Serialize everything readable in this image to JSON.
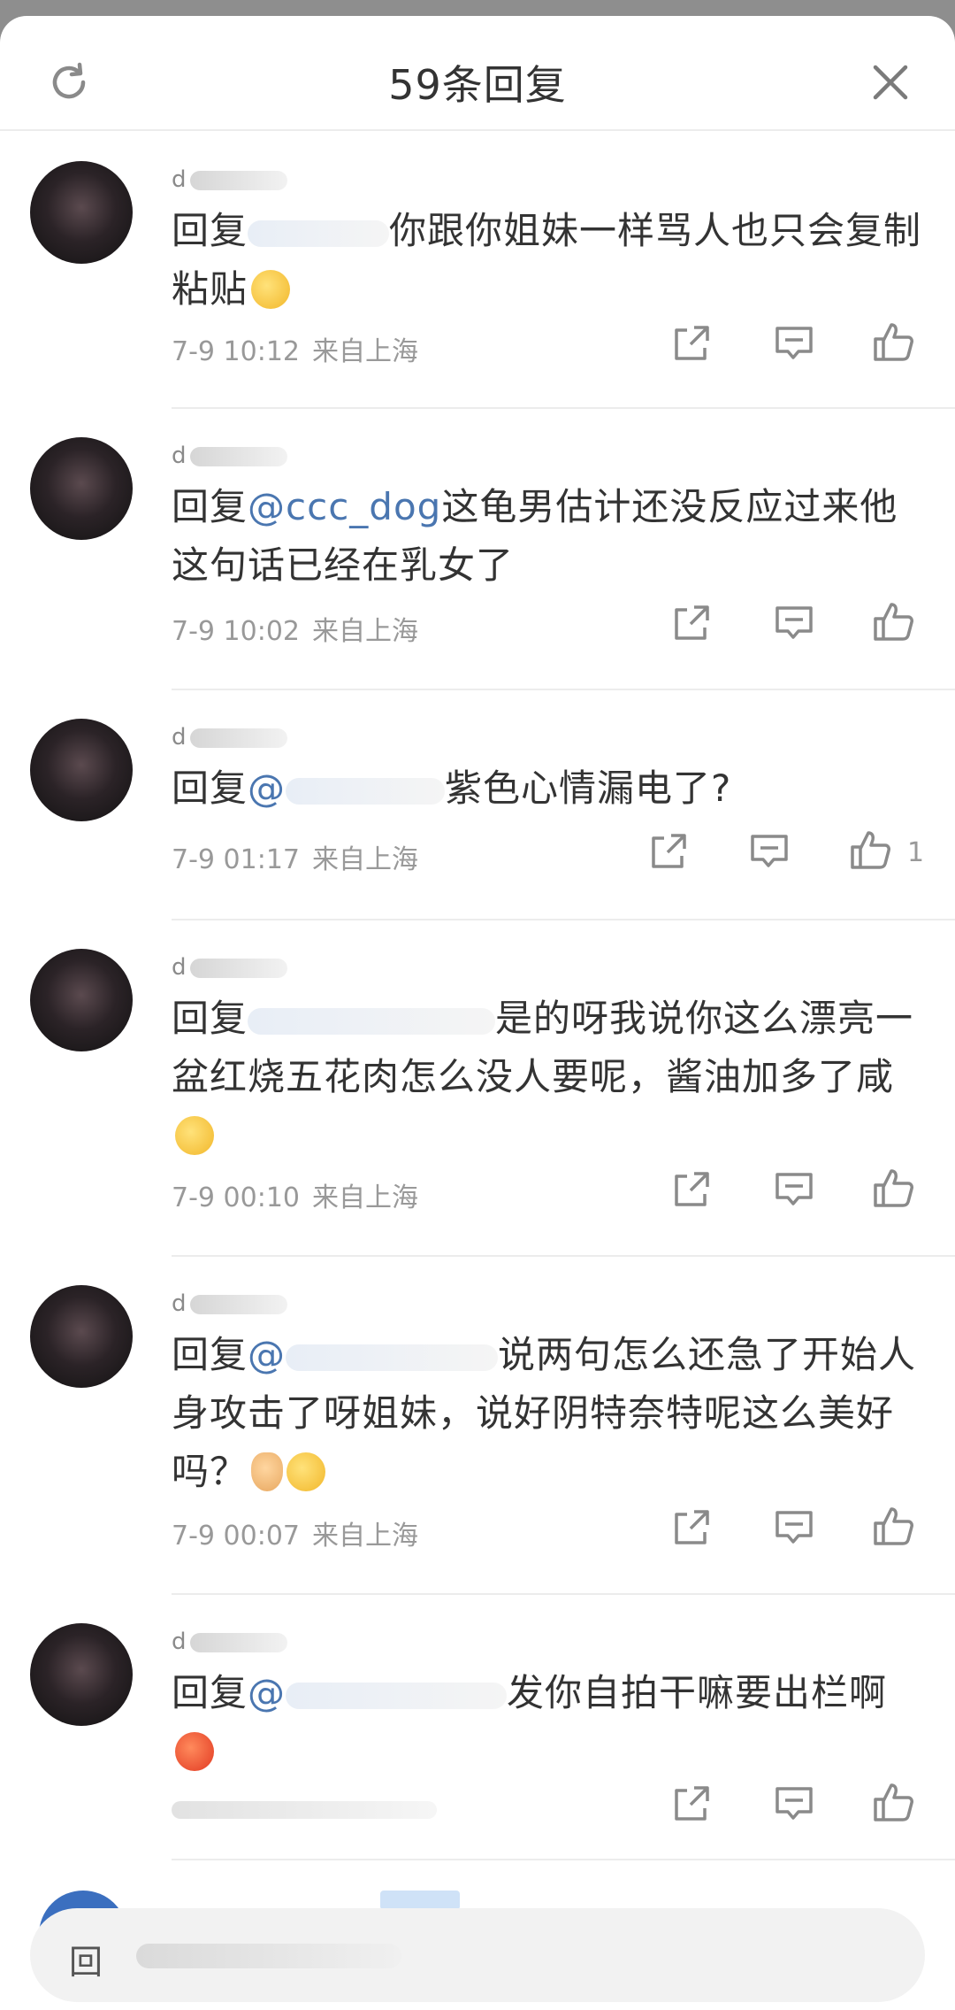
{
  "header": {
    "title": "59条回复"
  },
  "comments": [
    {
      "username": "d",
      "prefix": "回复",
      "mention": "",
      "text": "你跟你姐妹一样骂人也只会复制粘贴",
      "time": "7-9 10:12",
      "location": "来自上海",
      "likes": ""
    },
    {
      "username": "d",
      "prefix": "回复",
      "mention": "@ccc_dog",
      "text": "这龟男估计还没反应过来他这句话已经在乳女了",
      "time": "7-9 10:02",
      "location": "来自上海",
      "likes": ""
    },
    {
      "username": "d",
      "prefix": "回复",
      "mention": "@",
      "text": "紫色心情漏电了?",
      "time": "7-9 01:17",
      "location": "来自上海",
      "likes": "1"
    },
    {
      "username": "d",
      "prefix": "回复",
      "mention": "",
      "text": "是的呀我说你这么漂亮一盆红烧五花肉怎么没人要呢，酱油加多了咸",
      "time": "7-9 00:10",
      "location": "来自上海",
      "likes": ""
    },
    {
      "username": "d",
      "prefix": "回复",
      "mention": "@",
      "text": "说两句怎么还急了开始人身攻击了呀姐妹，说好阴特奈特呢这么美好吗？",
      "time": "7-9 00:07",
      "location": "来自上海",
      "likes": ""
    },
    {
      "username": "d",
      "prefix": "回复",
      "mention": "@",
      "text": "发你自拍干嘛要出栏啊",
      "time": "",
      "location": "",
      "likes": ""
    }
  ],
  "reply_bar": {
    "placeholder": "回"
  },
  "icons": {
    "refresh": "refresh-icon",
    "close": "close-icon",
    "share": "share-icon",
    "comment": "comment-icon",
    "like": "thumbs-up-icon"
  },
  "colors": {
    "mention": "#4a76b0",
    "text": "#333333",
    "meta": "#999999",
    "divider": "#ececec"
  }
}
